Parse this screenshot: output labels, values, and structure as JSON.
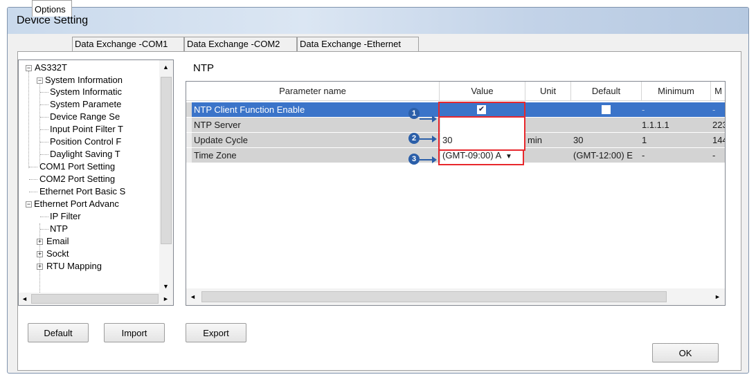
{
  "window": {
    "title": "Device Setting"
  },
  "tabs": [
    {
      "label": "Options"
    },
    {
      "label": "Data Exchange -COM1"
    },
    {
      "label": "Data Exchange -COM2"
    },
    {
      "label": "Data Exchange -Ethernet"
    }
  ],
  "tree": {
    "items": [
      {
        "label": "AS332T"
      },
      {
        "label": "System Information"
      },
      {
        "label": "System Informatic"
      },
      {
        "label": "System Paramete"
      },
      {
        "label": "Device Range Se"
      },
      {
        "label": "Input Point Filter T"
      },
      {
        "label": "Position Control F"
      },
      {
        "label": "Daylight Saving T"
      },
      {
        "label": "COM1 Port Setting"
      },
      {
        "label": "COM2 Port Setting"
      },
      {
        "label": "Ethernet Port Basic S"
      },
      {
        "label": "Ethernet Port Advanc"
      },
      {
        "label": "IP Filter"
      },
      {
        "label": "NTP"
      },
      {
        "label": "Email"
      },
      {
        "label": "Sockt"
      },
      {
        "label": "RTU Mapping"
      }
    ]
  },
  "section_title": "NTP",
  "grid": {
    "headers": [
      "Parameter name",
      "Value",
      "Unit",
      "Default",
      "Minimum",
      "M"
    ],
    "rows": [
      {
        "name": "NTP Client Function Enable",
        "value": "✔",
        "unit": "",
        "default": "",
        "min": "-",
        "max": "-"
      },
      {
        "name": "NTP Server",
        "value": "",
        "unit": "",
        "default": "",
        "min": "1.1.1.1",
        "max": "223"
      },
      {
        "name": "Update Cycle",
        "value": "30",
        "unit": "min",
        "default": "30",
        "min": "1",
        "max": "144"
      },
      {
        "name": "Time Zone",
        "value": "(GMT-09:00) A",
        "unit": "",
        "default": "(GMT-12:00) E",
        "min": "-",
        "max": "-"
      }
    ]
  },
  "callouts": [
    "1",
    "2",
    "3"
  ],
  "buttons": {
    "default": "Default",
    "import": "Import",
    "export": "Export",
    "ok": "OK"
  },
  "colors": {
    "selected_row": "#3b74c9",
    "highlight_box": "#e8272c",
    "callout": "#2b5fa9"
  },
  "icons": {
    "dropdown": "▼",
    "expanded": "−",
    "collapsed": "+",
    "scroll_up": "▲",
    "scroll_down": "▼",
    "scroll_left": "◄",
    "scroll_right": "►"
  }
}
